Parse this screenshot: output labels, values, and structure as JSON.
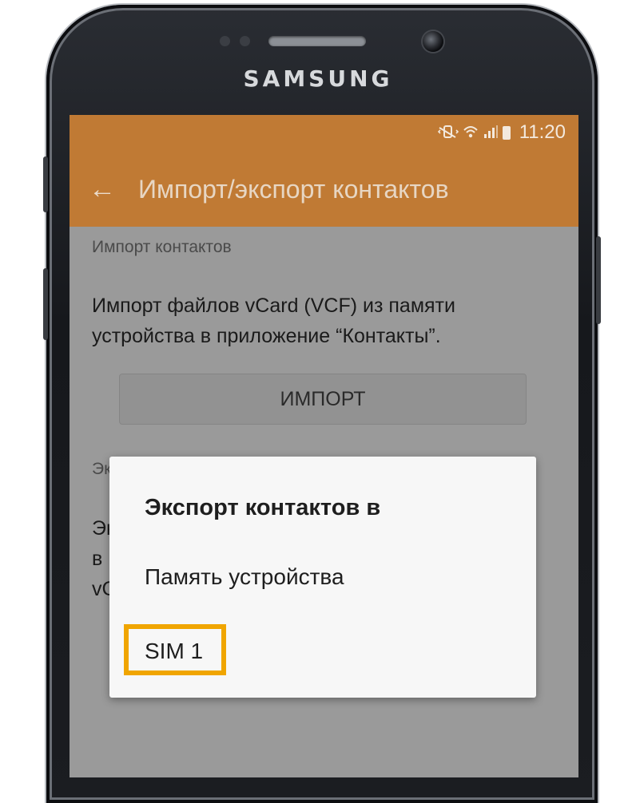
{
  "device": {
    "brand": "SAMSUNG"
  },
  "status_bar": {
    "time": "11:20",
    "icons": [
      "mute-vibrate-icon",
      "wifi-icon",
      "signal-icon",
      "battery-icon"
    ]
  },
  "app_bar": {
    "title": "Импорт/экспорт контактов",
    "back_icon": "back-arrow-icon",
    "background_color": "#c07a34"
  },
  "import_section": {
    "header": "Импорт контактов",
    "description_line1": "Импорт файлов vCard (VCF) из памяти",
    "description_line2": "устройства в приложение “Контакты”.",
    "button_label": "ИМПОРТ"
  },
  "export_section_fragments": {
    "header": "Эк",
    "line1": "Эк",
    "line2": "в",
    "line3": "vC"
  },
  "dialog": {
    "title": "Экспорт контактов в",
    "options": [
      "Память устройства",
      "SIM 1"
    ],
    "highlight_color": "#f0a500"
  }
}
